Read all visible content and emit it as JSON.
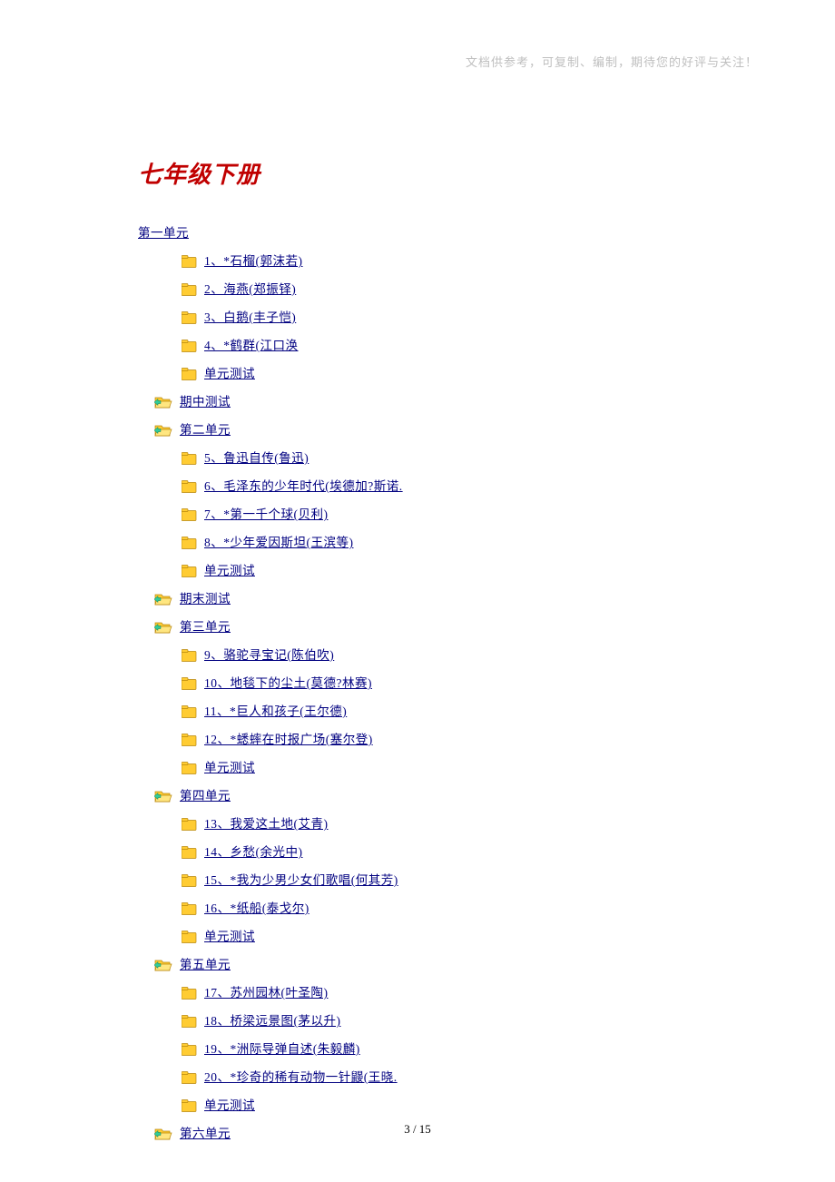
{
  "header_note": "文档供参考，可复制、编制，期待您的好评与关注！",
  "title": "七年级下册",
  "page_number": "3 / 15",
  "items": [
    {
      "level": 1,
      "icon": "none",
      "label": "第一单元"
    },
    {
      "level": 2,
      "icon": "closed",
      "label": "1、*石榴(郭沫若)"
    },
    {
      "level": 2,
      "icon": "closed",
      "label": "2、海燕(郑振铎)"
    },
    {
      "level": 2,
      "icon": "closed",
      "label": "3、白鹅(丰子恺)"
    },
    {
      "level": 2,
      "icon": "closed",
      "label": "4、*鹤群(江口涣"
    },
    {
      "level": 2,
      "icon": "closed",
      "label": "单元测试"
    },
    {
      "level": 1,
      "icon": "open",
      "label": "期中测试"
    },
    {
      "level": 1,
      "icon": "open",
      "label": "第二单元"
    },
    {
      "level": 2,
      "icon": "closed",
      "label": "5、鲁迅自传(鲁迅)"
    },
    {
      "level": 2,
      "icon": "closed",
      "label": "6、毛泽东的少年时代(埃德加?斯诺."
    },
    {
      "level": 2,
      "icon": "closed",
      "label": "7、*第一千个球(贝利)"
    },
    {
      "level": 2,
      "icon": "closed",
      "label": "8、*少年爱因斯坦(王滨等)"
    },
    {
      "level": 2,
      "icon": "closed",
      "label": "单元测试"
    },
    {
      "level": 1,
      "icon": "open",
      "label": "期末测试"
    },
    {
      "level": 1,
      "icon": "open",
      "label": "第三单元"
    },
    {
      "level": 2,
      "icon": "closed",
      "label": "9、骆驼寻宝记(陈伯吹)"
    },
    {
      "level": 2,
      "icon": "closed",
      "label": "10、地毯下的尘土(莫德?林赛)"
    },
    {
      "level": 2,
      "icon": "closed",
      "label": "11、*巨人和孩子(王尔德)"
    },
    {
      "level": 2,
      "icon": "closed",
      "label": "12、*蟋蟀在时报广场(塞尔登)"
    },
    {
      "level": 2,
      "icon": "closed",
      "label": "单元测试"
    },
    {
      "level": 1,
      "icon": "open",
      "label": "第四单元"
    },
    {
      "level": 2,
      "icon": "closed",
      "label": "13、我爱这土地(艾青)"
    },
    {
      "level": 2,
      "icon": "closed",
      "label": "14、乡愁(余光中)"
    },
    {
      "level": 2,
      "icon": "closed",
      "label": "15、*我为少男少女们歌唱(何其芳)"
    },
    {
      "level": 2,
      "icon": "closed",
      "label": "16、*纸船(泰戈尔)"
    },
    {
      "level": 2,
      "icon": "closed",
      "label": "单元测试"
    },
    {
      "level": 1,
      "icon": "open",
      "label": "第五单元"
    },
    {
      "level": 2,
      "icon": "closed",
      "label": "17、苏州园林(叶圣陶)"
    },
    {
      "level": 2,
      "icon": "closed",
      "label": "18、桥梁远景图(茅以升)"
    },
    {
      "level": 2,
      "icon": "closed",
      "label": "19、*洲际导弹自述(朱毅麟)"
    },
    {
      "level": 2,
      "icon": "closed",
      "label": "20、*珍奇的稀有动物一针鼹(王晓."
    },
    {
      "level": 2,
      "icon": "closed",
      "label": "单元测试"
    },
    {
      "level": 1,
      "icon": "open",
      "label": "第六单元"
    }
  ]
}
